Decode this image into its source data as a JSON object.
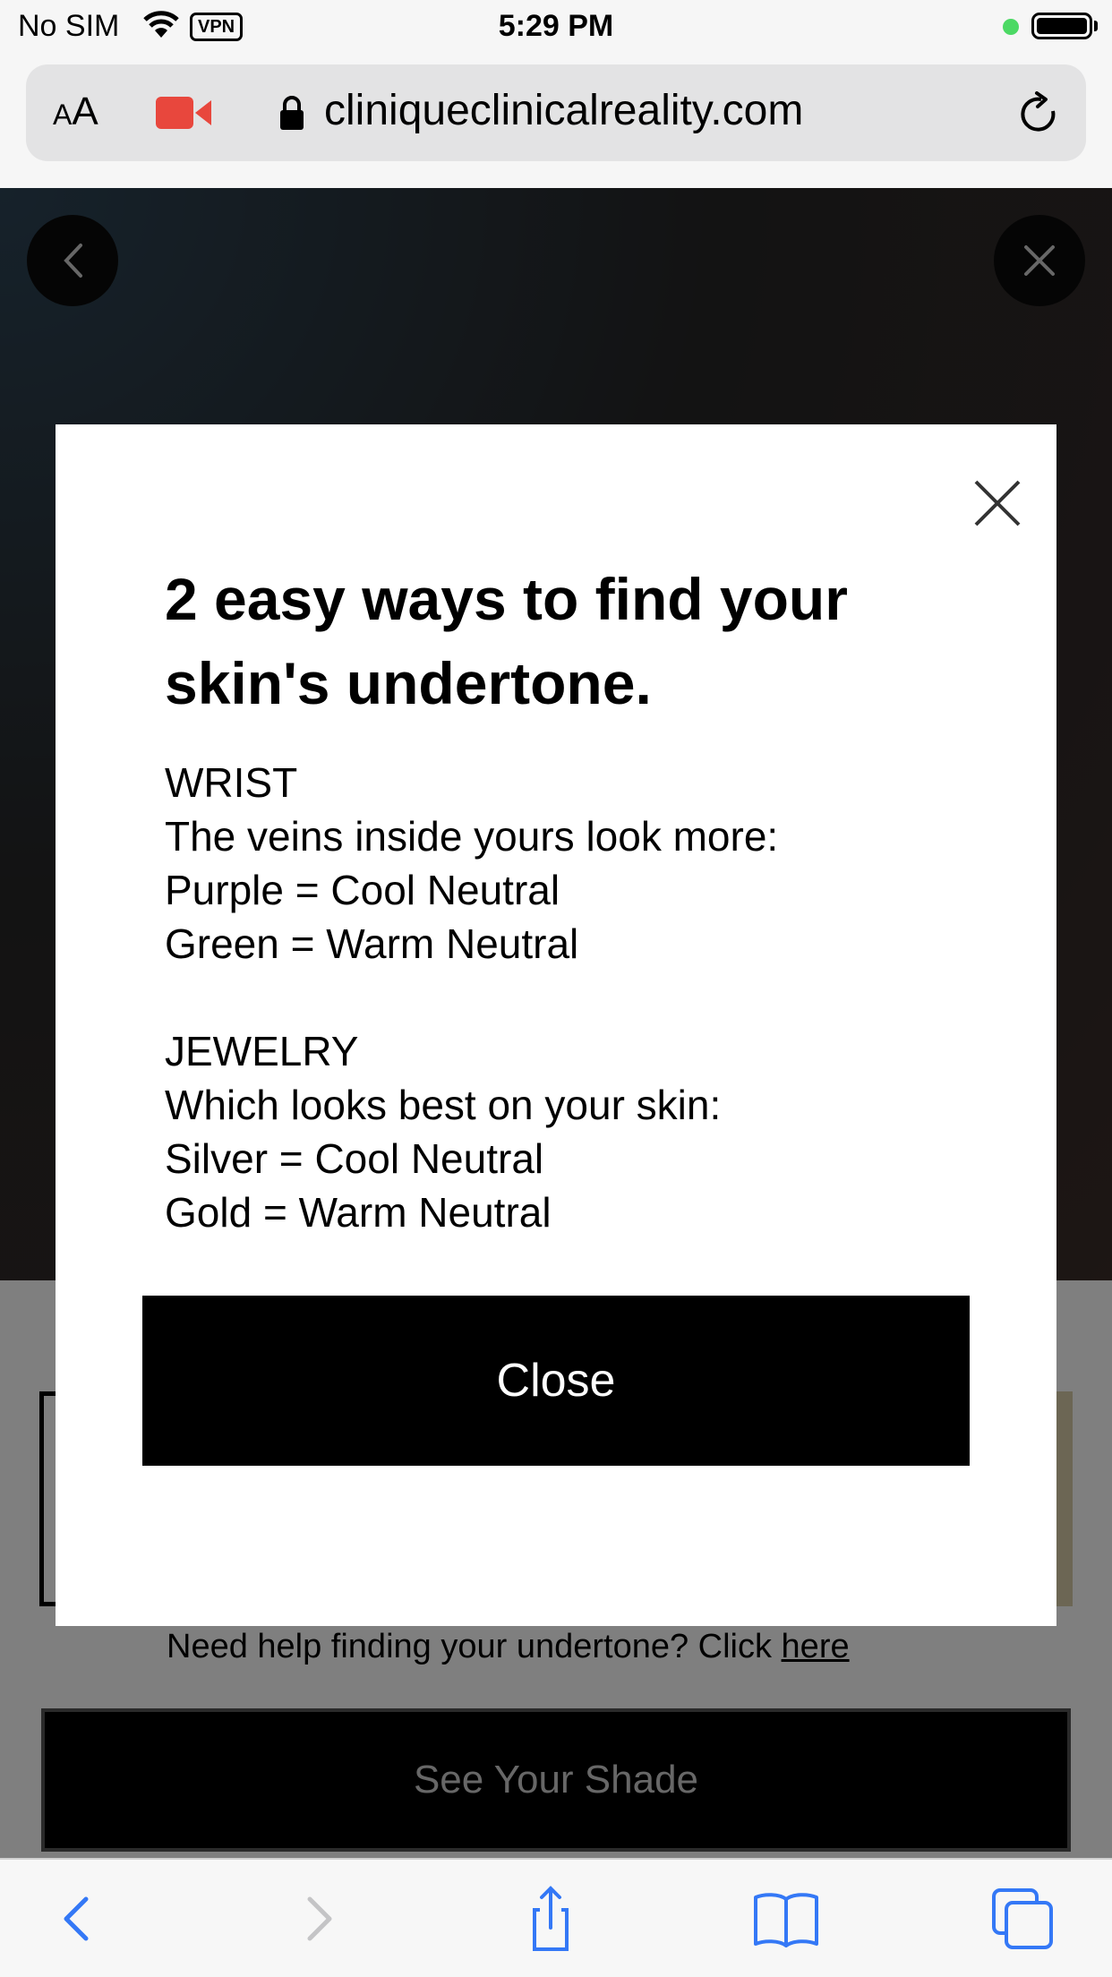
{
  "status_bar": {
    "carrier": "No SIM",
    "vpn": "VPN",
    "time": "5:29 PM"
  },
  "browser": {
    "text_size_small": "A",
    "text_size_large": "A",
    "url": "cliniqueclinicalreality.com"
  },
  "page": {
    "help_text": "Need help finding your undertone? Click ",
    "help_link": "here",
    "see_shade_button": "See Your Shade"
  },
  "modal": {
    "title": "2 easy ways to find your skin's undertone.",
    "wrist": {
      "heading": "WRIST",
      "question": "The veins inside yours look more:",
      "option_1": "Purple = Cool Neutral",
      "option_2": "Green = Warm Neutral"
    },
    "jewelry": {
      "heading": "JEWELRY",
      "question": "Which looks best on your skin:",
      "option_1": "Silver = Cool Neutral",
      "option_2": "Gold = Warm Neutral"
    },
    "close_button": "Close"
  },
  "colors": {
    "accent_blue": "#3478f6",
    "camera_red": "#e8473d",
    "mic_green": "#4cd964"
  },
  "icons": [
    "wifi-icon",
    "camera-icon",
    "lock-icon",
    "reload-icon",
    "back-icon",
    "close-icon",
    "share-icon",
    "bookmarks-icon",
    "tabs-icon"
  ]
}
